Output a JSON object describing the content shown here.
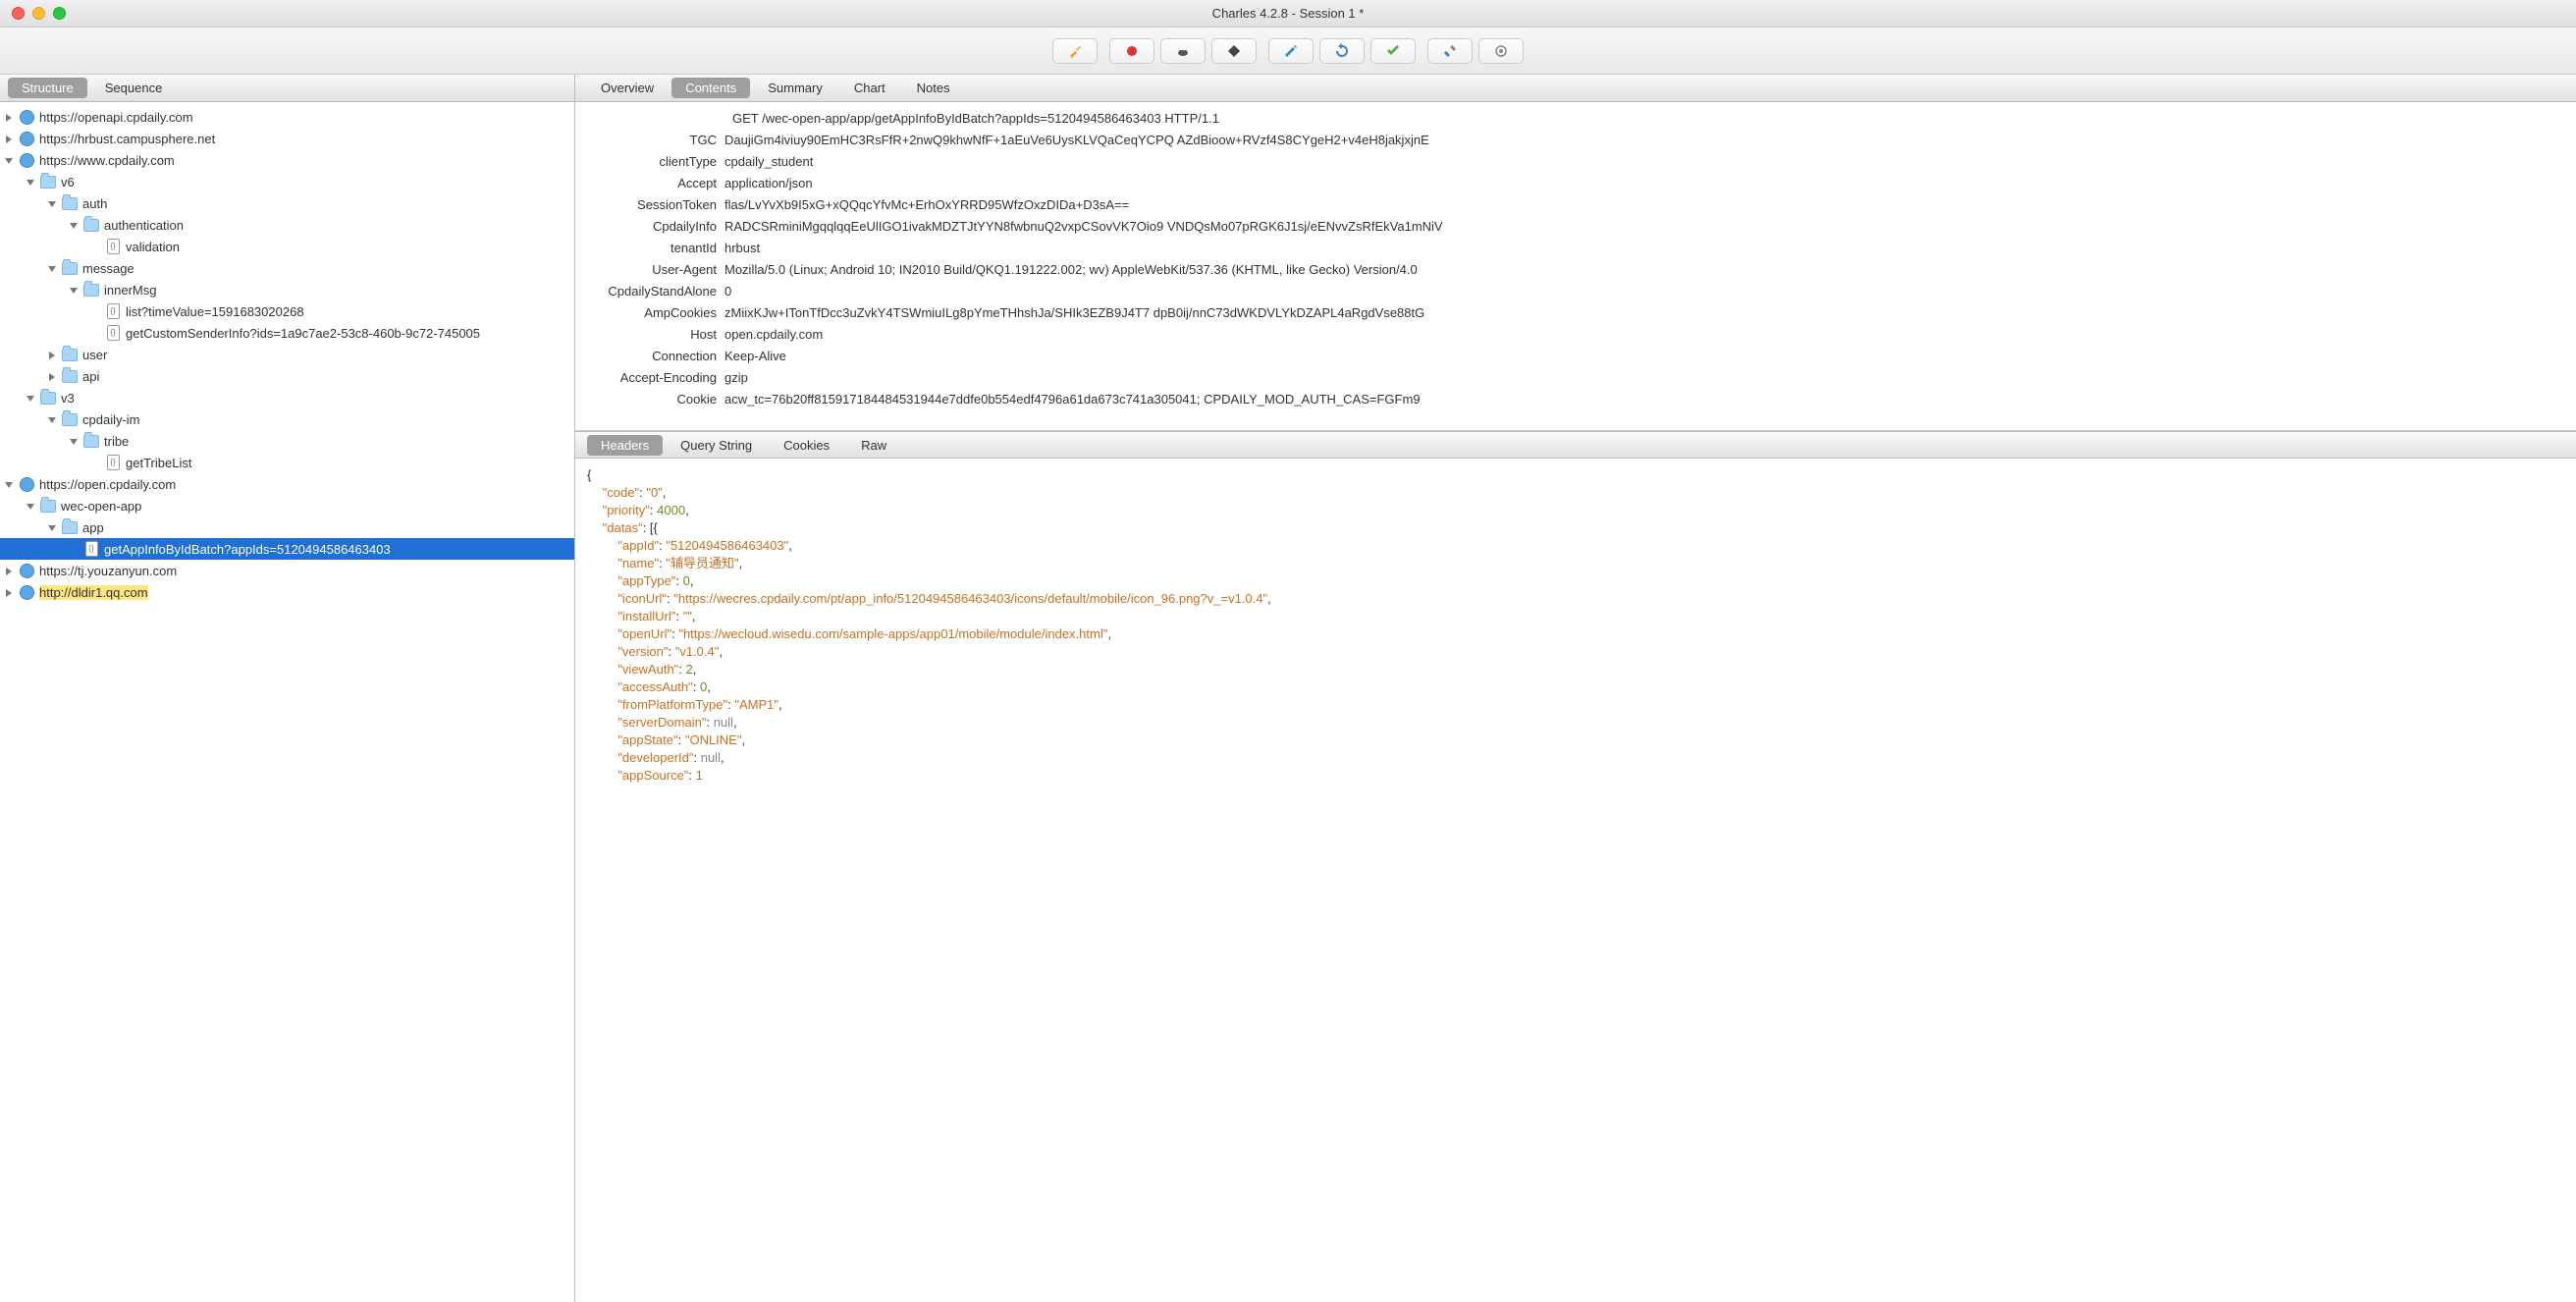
{
  "window_title": "Charles 4.2.8 - Session 1 *",
  "left_tabs": {
    "structure": "Structure",
    "sequence": "Sequence"
  },
  "right_tabs": {
    "overview": "Overview",
    "contents": "Contents",
    "summary": "Summary",
    "chart": "Chart",
    "notes": "Notes"
  },
  "sub_tabs": {
    "headers": "Headers",
    "query": "Query String",
    "cookies": "Cookies",
    "raw": "Raw"
  },
  "tree": {
    "h0": "https://openapi.cpdaily.com",
    "h1": "https://hrbust.campusphere.net",
    "h2": "https://www.cpdaily.com",
    "v6": "v6",
    "auth": "auth",
    "authentication": "authentication",
    "validation": "validation",
    "message": "message",
    "innerMsg": "innerMsg",
    "listTime": "list?timeValue=1591683020268",
    "getCustom": "getCustomSenderInfo?ids=1a9c7ae2-53c8-460b-9c72-745005",
    "user": "user",
    "api": "api",
    "v3": "v3",
    "cpdailyim": "cpdaily-im",
    "tribe": "tribe",
    "getTribeList": "getTribeList",
    "h3": "https://open.cpdaily.com",
    "wecopenapp": "wec-open-app",
    "app": "app",
    "getAppInfo": "getAppInfoByIdBatch?appIds=5120494586463403",
    "h4": "https://tj.youzanyun.com",
    "h5": "http://dldir1.qq.com"
  },
  "request_line": "GET /wec-open-app/app/getAppInfoByIdBatch?appIds=5120494586463403 HTTP/1.1",
  "headers": [
    {
      "k": "TGC",
      "v": "DaujiGm4iviuy90EmHC3RsFfR+2nwQ9khwNfF+1aEuVe6UysKLVQaCeqYCPQ AZdBioow+RVzf4S8CYgeH2+v4eH8jakjxjnE"
    },
    {
      "k": "clientType",
      "v": "cpdaily_student"
    },
    {
      "k": "Accept",
      "v": "application/json"
    },
    {
      "k": "SessionToken",
      "v": "flas/LvYvXb9I5xG+xQQqcYfvMc+ErhOxYRRD95WfzOxzDIDa+D3sA=="
    },
    {
      "k": "CpdailyInfo",
      "v": "RADCSRminiMgqqlqqEeUlIGO1ivakMDZTJtYYN8fwbnuQ2vxpCSovVK7Oio9 VNDQsMo07pRGK6J1sj/eENvvZsRfEkVa1mNiV"
    },
    {
      "k": "tenantId",
      "v": "hrbust"
    },
    {
      "k": "User-Agent",
      "v": "Mozilla/5.0 (Linux; Android 10; IN2010 Build/QKQ1.191222.002; wv) AppleWebKit/537.36 (KHTML, like Gecko) Version/4.0"
    },
    {
      "k": "CpdailyStandAlone",
      "v": "0"
    },
    {
      "k": "AmpCookies",
      "v": "zMiixKJw+ITonTfDcc3uZvkY4TSWmiuILg8pYmeTHhshJa/SHIk3EZB9J4T7 dpB0ij/nnC73dWKDVLYkDZAPL4aRgdVse88tG"
    },
    {
      "k": "Host",
      "v": "open.cpdaily.com"
    },
    {
      "k": "Connection",
      "v": "Keep-Alive"
    },
    {
      "k": "Accept-Encoding",
      "v": "gzip"
    },
    {
      "k": "Cookie",
      "v": "acw_tc=76b20ff815917184484531944e7ddfe0b554edf4796a61da673c741a305041; CPDAILY_MOD_AUTH_CAS=FGFm9"
    }
  ],
  "json": {
    "code": "0",
    "priority": 4000,
    "appId": "5120494586463403",
    "name": "辅导员通知",
    "appType": 0,
    "iconUrl": "https://wecres.cpdaily.com/pt/app_info/5120494586463403/icons/default/mobile/icon_96.png?v_=v1.0.4",
    "installUrl": "",
    "openUrl": "https://wecloud.wisedu.com/sample-apps/app01/mobile/module/index.html",
    "version": "v1.0.4",
    "viewAuth": 2,
    "accessAuth": 0,
    "fromPlatformType": "AMP1",
    "serverDomain": "null",
    "appState": "ONLINE",
    "developerId": "null",
    "appSource": 1
  }
}
